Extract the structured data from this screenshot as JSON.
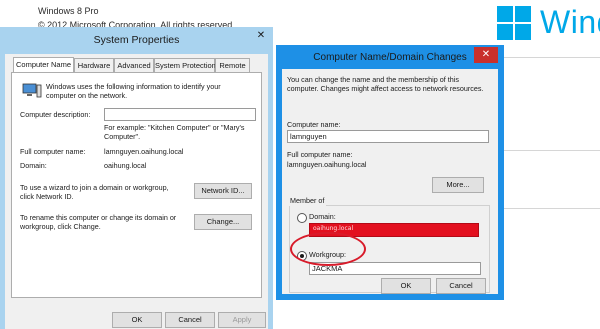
{
  "desktop": {
    "edition": "Windows 8 Pro",
    "copyright": "© 2012 Microsoft Corporation. All rights reserved.",
    "brand": "Wind",
    "colors": {
      "brand": "#00a8e8"
    }
  },
  "system_properties": {
    "title": "System Properties",
    "close_icon": "close-icon",
    "tabs": [
      "Computer Name",
      "Hardware",
      "Advanced",
      "System Protection",
      "Remote"
    ],
    "intro": "Windows uses the following information to identify your computer on the network.",
    "description_label": "Computer description:",
    "description_value": "",
    "description_example": "For example: \"Kitchen Computer\" or \"Mary's Computer\".",
    "full_name_label": "Full computer name:",
    "full_name_value": "lamnguyen.oaihung.local",
    "domain_label": "Domain:",
    "domain_value": "oaihung.local",
    "network_id_text": "To use a wizard to join a domain or workgroup, click Network ID.",
    "network_id_button": "Network ID...",
    "rename_text": "To rename this computer or change its domain or workgroup, click Change.",
    "change_button": "Change...",
    "ok_button": "OK",
    "cancel_button": "Cancel",
    "apply_button": "Apply"
  },
  "domain_changes": {
    "title": "Computer Name/Domain Changes",
    "close_icon": "close-icon",
    "intro": "You can change the name and the membership of this computer. Changes might affect access to network resources.",
    "computer_name_label": "Computer name:",
    "computer_name_value": "lamnguyen",
    "full_name_label": "Full computer name:",
    "full_name_value": "lamnguyen.oaihung.local",
    "more_button": "More...",
    "member_of_label": "Member of",
    "domain_radio_label": "Domain:",
    "domain_field_value": "oaihung.local",
    "workgroup_radio_label": "Workgroup:",
    "workgroup_value": "JACKMA",
    "selected_membership": "workgroup",
    "ok_button": "OK",
    "cancel_button": "Cancel",
    "annotation_color": "#d81b2a"
  }
}
